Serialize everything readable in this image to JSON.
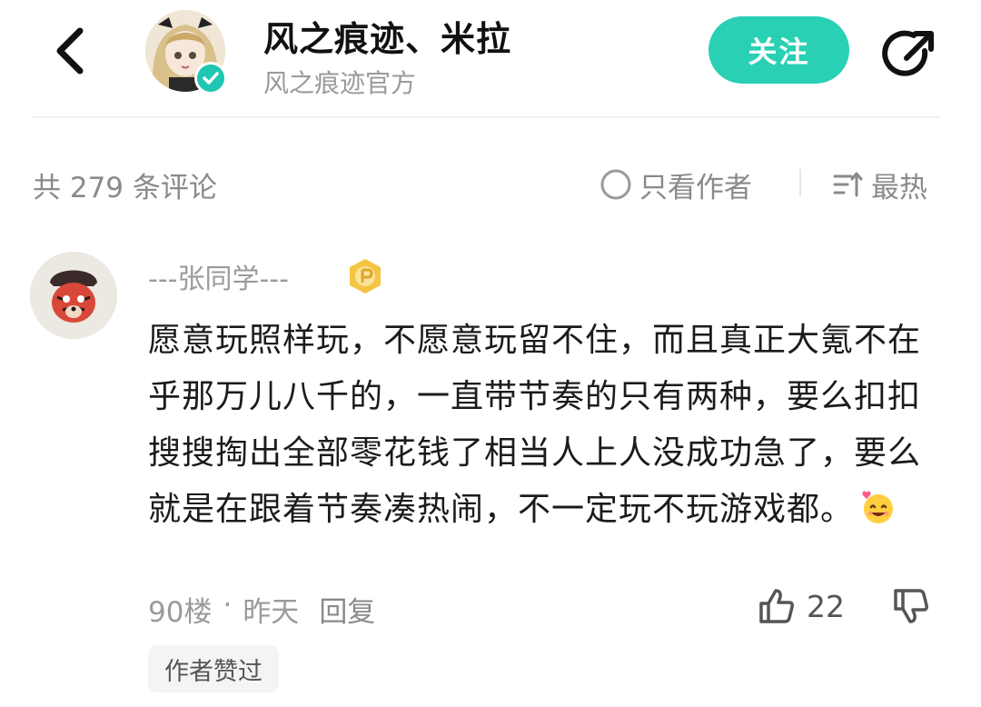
{
  "header": {
    "back_icon": "chevron-left-icon",
    "user_name": "风之痕迹、米拉",
    "user_subtitle": "风之痕迹官方",
    "verified_icon": "verified-check-icon",
    "follow_label": "关注",
    "share_icon": "share-icon",
    "accent_color": "#29d0b3"
  },
  "comment_bar": {
    "count_label": "共 279 条评论",
    "only_author_label": "只看作者",
    "sort_label": "最热",
    "sort_icon": "sort-icon"
  },
  "comment": {
    "username": "---张同学---",
    "badge_icon": "level-badge-icon",
    "text": "愿意玩照样玩，不愿意玩留不住，而且真正大氪不在乎那万儿八千的，一直带节奏的只有两种，要么扣扣搜搜掏出全部零花钱了相当人上人没成功急了，要么就是在跟着节奏凑热闹，不一定玩不玩游戏都。",
    "emoji_icon": "grinning-heart-emoji-icon",
    "floor": "90楼",
    "dot": "·",
    "time": "昨天",
    "reply_label": "回复",
    "like_count": "22",
    "author_liked_label": "作者赞过"
  }
}
